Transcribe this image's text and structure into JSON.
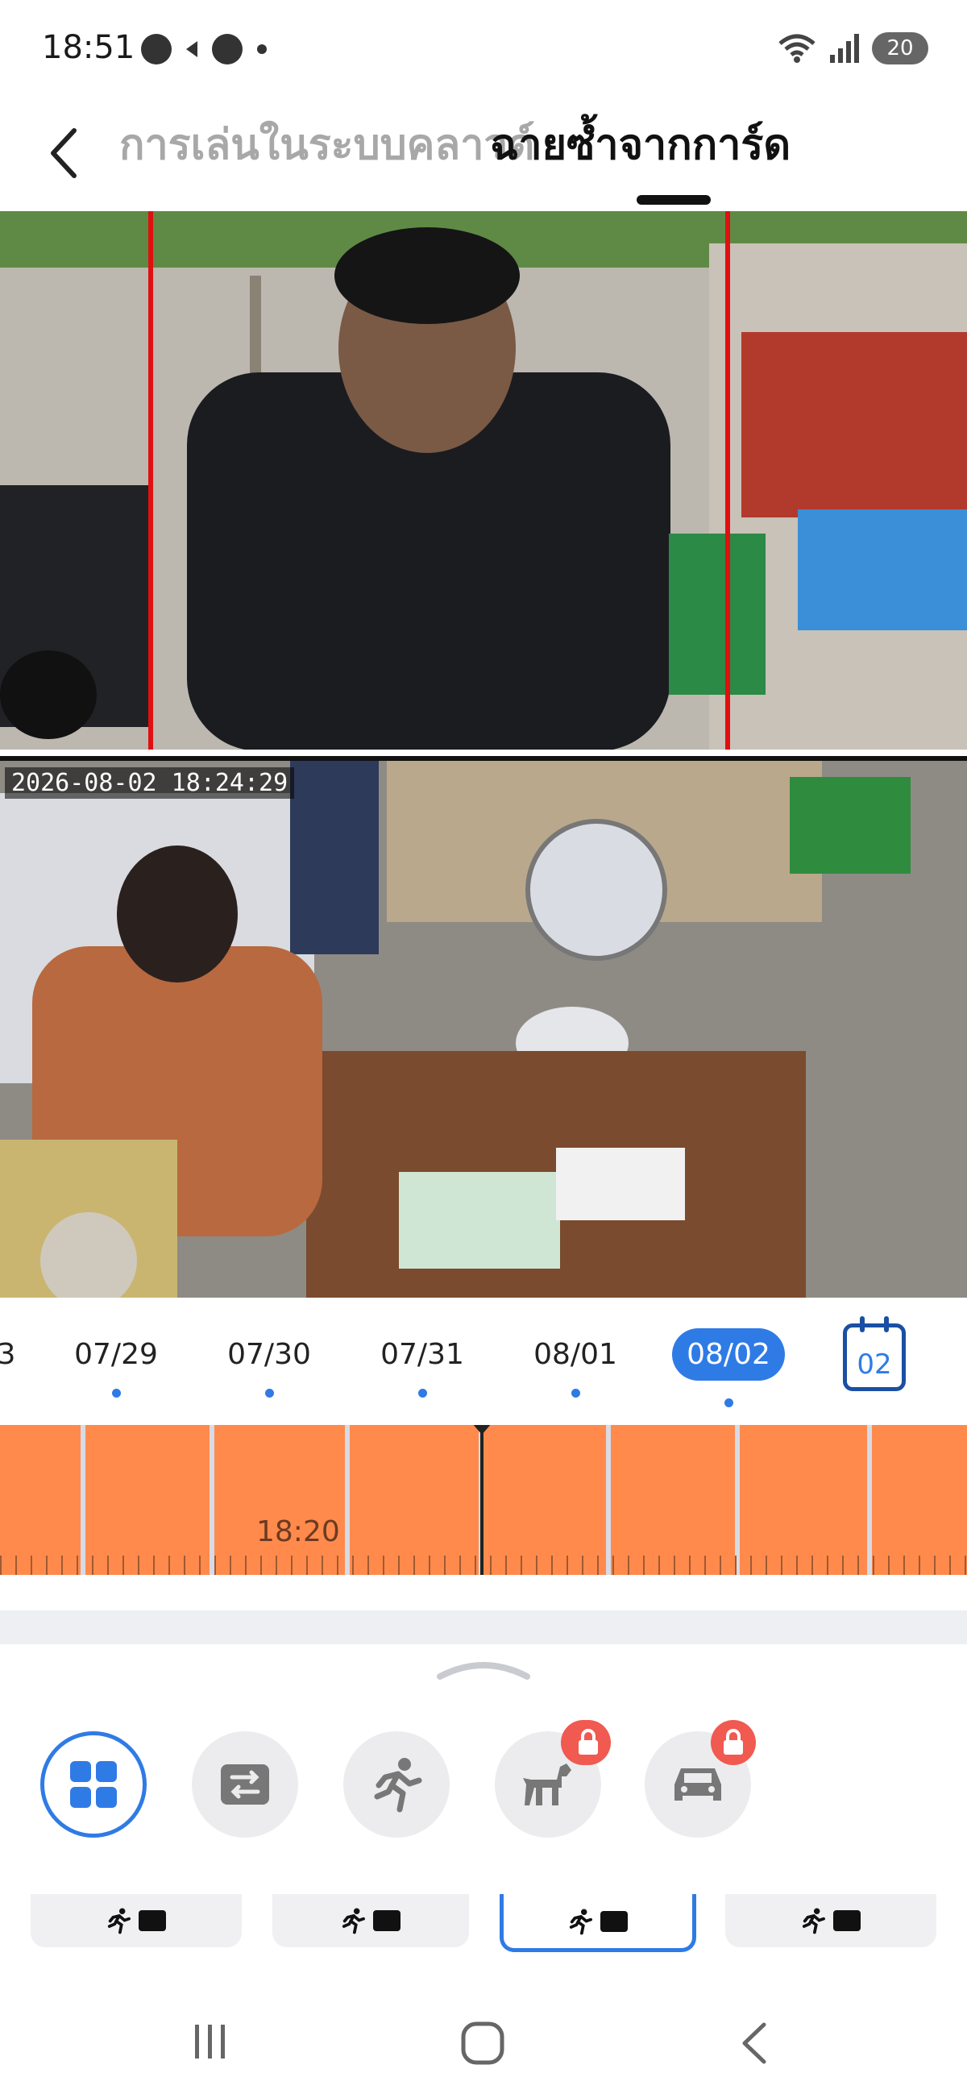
{
  "status_bar": {
    "time": "18:51",
    "battery": "20"
  },
  "header": {
    "tab_inactive": "การเล่นในระบบคลาวด์",
    "tab_active": "ฉายซ้ำจากการ์ด"
  },
  "video": {
    "timestamp": "2026-08-02 18:24:29"
  },
  "dates": {
    "partial": "3",
    "items": [
      "07/29",
      "07/30",
      "07/31",
      "08/01",
      "08/02"
    ],
    "selected": "08/02",
    "calendar_day": "02"
  },
  "timeline": {
    "label": "18:20",
    "color": "#ff8a4c"
  },
  "colors": {
    "accent": "#2f7be6",
    "lock": "#f05a50"
  },
  "filters": [
    {
      "icon": "grid-icon",
      "locked": false,
      "active": true
    },
    {
      "icon": "switch-icon",
      "locked": false,
      "active": false
    },
    {
      "icon": "running-person-icon",
      "locked": true,
      "active": false
    },
    {
      "icon": "pet-icon",
      "locked": true,
      "active": false
    },
    {
      "icon": "car-icon",
      "locked": true,
      "active": false
    }
  ],
  "clips": [
    "clip-1",
    "clip-2",
    "clip-3",
    "clip-4"
  ]
}
